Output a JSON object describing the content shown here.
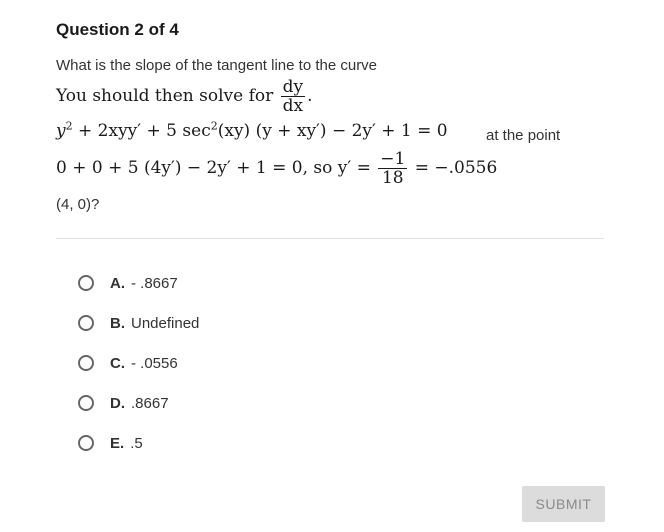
{
  "question": {
    "header": "Question 2 of 4",
    "prompt": "What is the slope of the tangent line to the curve",
    "solve_text": "You should then solve for",
    "solve_frac_num": "dy",
    "solve_frac_den": "dx",
    "eq1_a": "y",
    "eq1_b": " + 2xyy′ + 5 sec",
    "eq1_c": "(xy) (y + xy′) − 2y′ + 1 = 0",
    "at_point": "at the point",
    "eq2_a": "0 + 0 + 5 (4y′) − 2y′ + 1 = 0,  so y′ =",
    "eq2_num": "−1",
    "eq2_den": "18",
    "eq2_b": "= −.0556",
    "point": "(4, 0)?"
  },
  "options": [
    {
      "letter": "A.",
      "text": "- .8667"
    },
    {
      "letter": "B.",
      "text": "Undefined"
    },
    {
      "letter": "C.",
      "text": "- .0556"
    },
    {
      "letter": "D.",
      "text": ".8667"
    },
    {
      "letter": "E.",
      "text": ".5"
    }
  ],
  "submit_label": "SUBMIT"
}
